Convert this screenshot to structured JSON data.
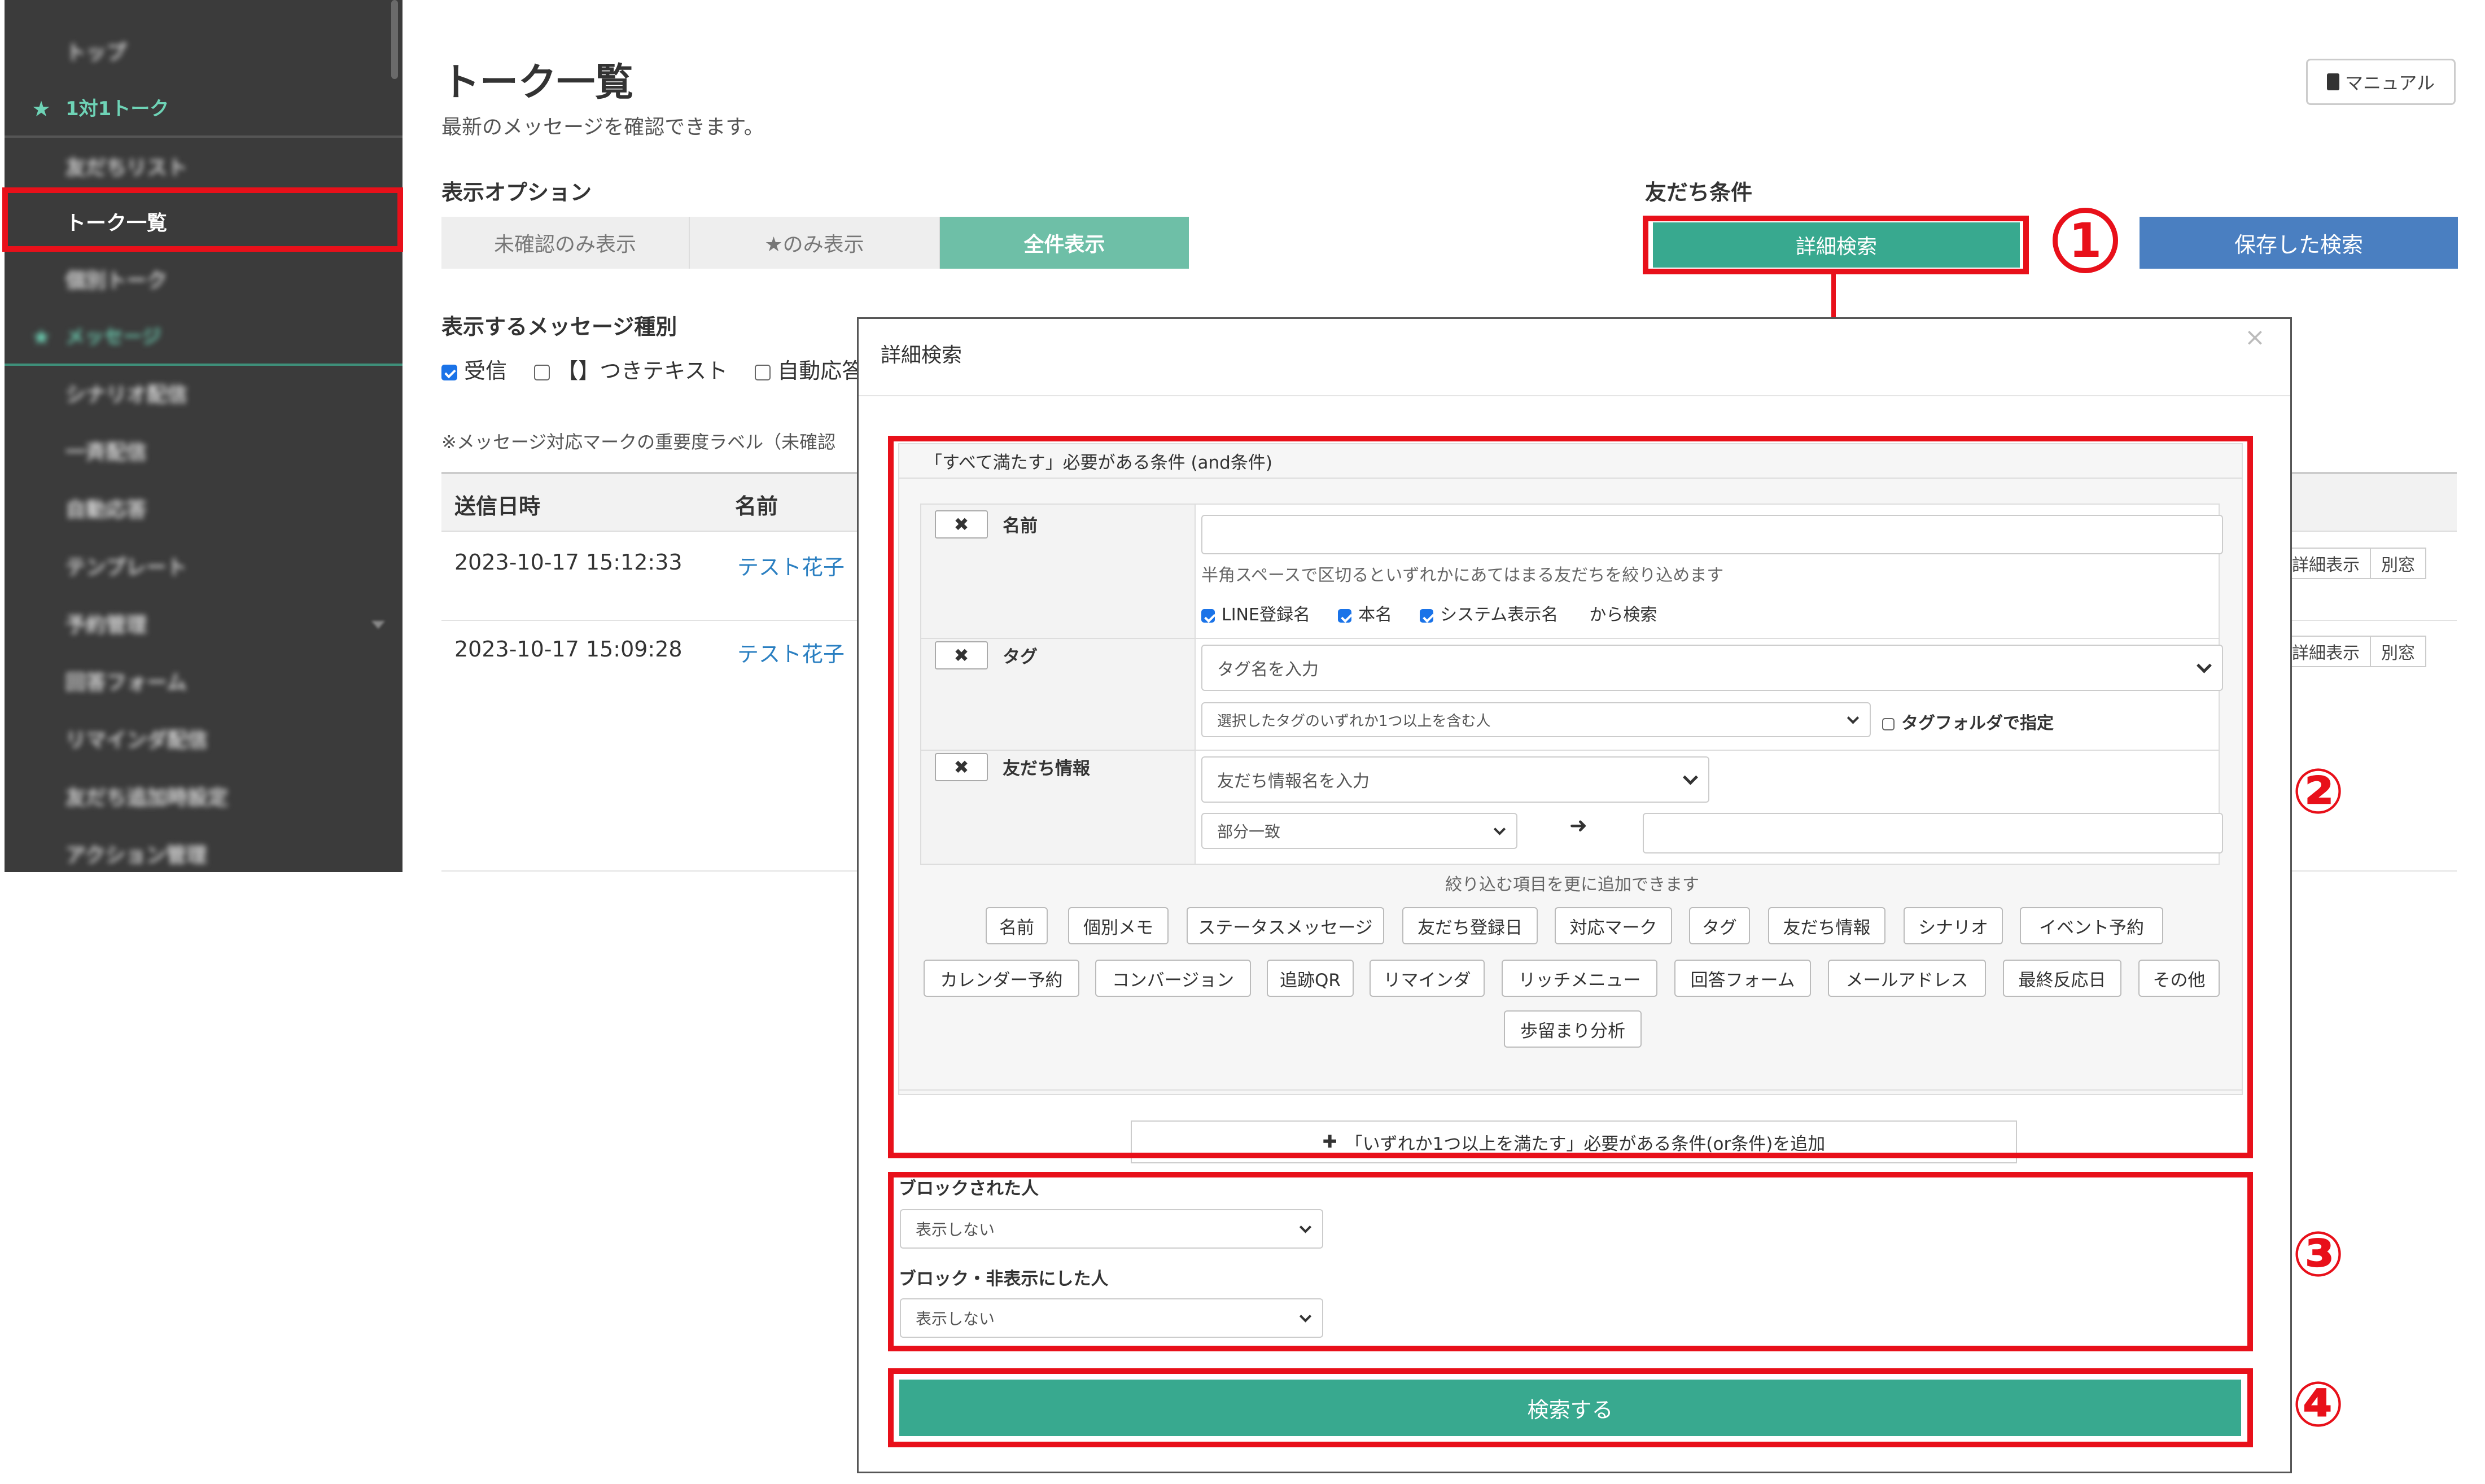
{
  "sidebar": {
    "items": [
      {
        "label": "トップ"
      },
      {
        "label": "1対1トーク"
      },
      {
        "label": "友だちリスト"
      },
      {
        "label": "トーク一覧"
      },
      {
        "label": "個別トーク"
      },
      {
        "label": "メッセージ"
      },
      {
        "label": "シナリオ配信"
      },
      {
        "label": "一斉配信"
      },
      {
        "label": "自動応答"
      },
      {
        "label": "テンプレート"
      },
      {
        "label": "予約管理"
      },
      {
        "label": "回答フォーム"
      },
      {
        "label": "リマインダ配信"
      },
      {
        "label": "友だち追加時設定"
      },
      {
        "label": "アクション管理"
      }
    ]
  },
  "page": {
    "title": "トーク一覧",
    "subtitle": "最新のメッセージを確認できます。",
    "manual_label": "マニュアル"
  },
  "display_options": {
    "label": "表示オプション",
    "segments": [
      "未確認のみ表示",
      "★のみ表示",
      "全件表示"
    ],
    "active_index": 2
  },
  "friend_conditions": {
    "label": "友だち条件",
    "detail_search": "詳細検索",
    "saved_search": "保存した検索"
  },
  "message_types": {
    "label": "表示するメッセージ種別",
    "options": [
      {
        "label": "受信",
        "checked": true
      },
      {
        "label": "【】つきテキスト",
        "checked": false
      },
      {
        "label": "自動応答",
        "checked": false
      }
    ]
  },
  "note": "※メッセージ対応マークの重要度ラベル（未確認",
  "table": {
    "headers": [
      "送信日時",
      "名前"
    ],
    "rows": [
      {
        "datetime": "2023-10-17 15:12:33",
        "name": "テスト花子",
        "detail": "詳細表示",
        "window": "別窓"
      },
      {
        "datetime": "2023-10-17 15:09:28",
        "name": "テスト花子",
        "detail": "詳細表示",
        "window": "別窓"
      }
    ]
  },
  "modal": {
    "title": "詳細検索",
    "close": "×",
    "and_header": "「すべて満たす」必要がある条件 (and条件)",
    "conditions": {
      "name": {
        "label": "名前",
        "value": "",
        "hint": "半角スペースで区切るといずれかにあてはまる友だちを絞り込めます",
        "checks": [
          "LINE登録名",
          "本名",
          "システム表示名"
        ],
        "checks_suffix": "から検索"
      },
      "tag": {
        "label": "タグ",
        "placeholder": "タグ名を入力",
        "mode": "選択したタグのいずれか1つ以上を含む人",
        "folder_label": "タグフォルダで指定"
      },
      "friend_info": {
        "label": "友だち情報",
        "placeholder": "友だち情報名を入力",
        "match": "部分一致",
        "arrow": "➜",
        "value": ""
      },
      "remove": "✖"
    },
    "more_hint": "絞り込む項目を更に追加できます",
    "chips_row1": [
      "名前",
      "個別メモ",
      "ステータスメッセージ",
      "友だち登録日",
      "対応マーク",
      "タグ",
      "友だち情報",
      "シナリオ",
      "イベント予約"
    ],
    "chips_row2": [
      "カレンダー予約",
      "コンバージョン",
      "追跡QR",
      "リマインダ",
      "リッチメニュー",
      "回答フォーム",
      "メールアドレス",
      "最終反応日",
      "その他"
    ],
    "chips_row3": [
      "歩留まり分析"
    ],
    "add_or": "「いずれか1つ以上を満たす」必要がある条件(or条件)を追加",
    "add_or_icon": "✚",
    "blocked": {
      "label": "ブロックされた人",
      "value": "表示しない"
    },
    "blocked_hidden": {
      "label": "ブロック・非表示にした人",
      "value": "表示しない"
    },
    "search_button": "検索する"
  },
  "annotations": {
    "n1": "1",
    "n2": "②",
    "n3": "③",
    "n4": "④",
    "color": "#e8101a"
  },
  "colors": {
    "sidebar_bg": "#3b3b3b",
    "accent_teal": "#38a98f",
    "accent_blue": "#4a7fc1",
    "link": "#2a7fc1"
  }
}
